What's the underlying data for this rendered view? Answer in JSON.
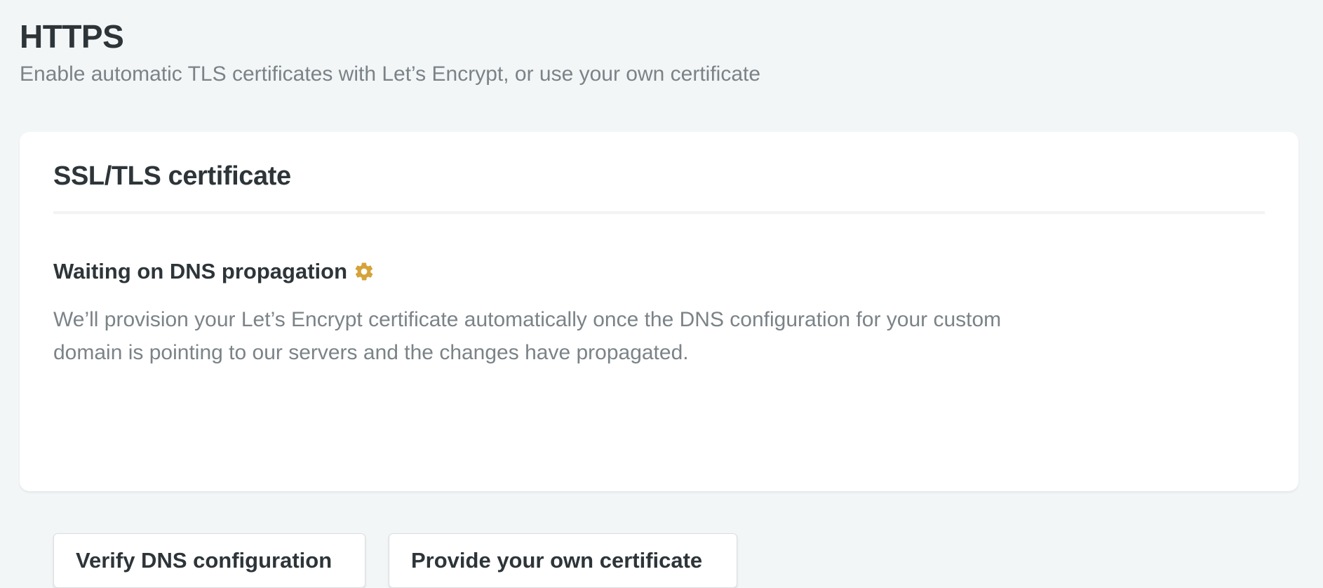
{
  "header": {
    "title": "HTTPS",
    "subtitle": "Enable automatic TLS certificates with Let’s Encrypt, or use your own certificate"
  },
  "card": {
    "title": "SSL/TLS certificate",
    "status": {
      "label": "Waiting on DNS propagation",
      "icon": "gear-icon",
      "icon_color": "#d5a33a",
      "description": "We’ll provision your Let’s Encrypt certificate automatically once the DNS configuration for your custom domain is pointing to our servers and the changes have propagated."
    },
    "actions": {
      "verify_label": "Verify DNS configuration",
      "provide_label": "Provide your own certificate"
    }
  },
  "colors": {
    "background": "#f3f6f7",
    "text_primary": "#2d3539",
    "text_secondary": "#7b8387",
    "card_background": "#ffffff"
  }
}
